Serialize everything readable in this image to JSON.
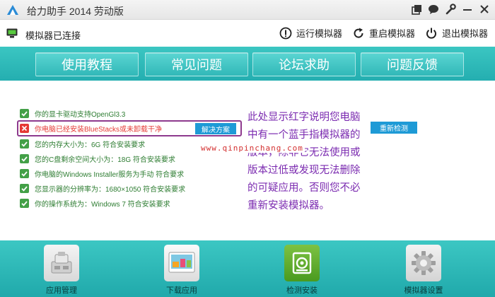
{
  "window": {
    "title": "给力助手 2014 劳动版"
  },
  "status": {
    "connection_text": "模拟器已连接"
  },
  "actions": [
    {
      "label": "运行模拟器",
      "icon": "info-circle-icon"
    },
    {
      "label": "重启模拟器",
      "icon": "refresh-icon"
    },
    {
      "label": "退出模拟器",
      "icon": "power-icon"
    }
  ],
  "tabs": [
    {
      "label": "使用教程"
    },
    {
      "label": "常见问题"
    },
    {
      "label": "论坛求助"
    },
    {
      "label": "问题反馈"
    }
  ],
  "checks": [
    {
      "text": "你的显卡驱动支持OpenGl3.3",
      "status": "ok"
    },
    {
      "text": "你电脑已经安装BlueStacks或未卸载干净",
      "status": "error"
    },
    {
      "text": "您的内存大小为：6G 符合安装要求",
      "status": "ok"
    },
    {
      "text": "您的C盘剩余空间大小为：18G 符合安装要求",
      "status": "ok"
    },
    {
      "text": "你电脑的Windows Installer服务为手动 符合要求",
      "status": "ok"
    },
    {
      "text": "您显示器的分辨率为：1680×1050 符合安装要求",
      "status": "ok"
    },
    {
      "text": "你的操作系统为：Windows 7 符合安装要求",
      "status": "ok"
    }
  ],
  "fix_button": "解决方案",
  "recheck_button": "重新检测",
  "annotation": "此处显示红字说明您电脑中有一个蓝手指模拟器的版本，除非它无法使用或版本过低或发现无法删除的可疑应用。否则您不必重新安装模拟器。",
  "watermark": "www.qinpinchang.com",
  "bottom": [
    {
      "label": "应用管理",
      "icon": "app-manage-icon"
    },
    {
      "label": "下载应用",
      "icon": "download-app-icon"
    },
    {
      "label": "检测安装",
      "icon": "detect-install-icon"
    },
    {
      "label": "模拟器设置",
      "icon": "settings-gear-icon"
    }
  ],
  "colors": {
    "accent_teal": "#2bb8b6",
    "ok_green": "#2e7d32",
    "error_red": "#e53935",
    "button_blue": "#1e9ad6",
    "annotation_purple": "#7b2bb0"
  }
}
